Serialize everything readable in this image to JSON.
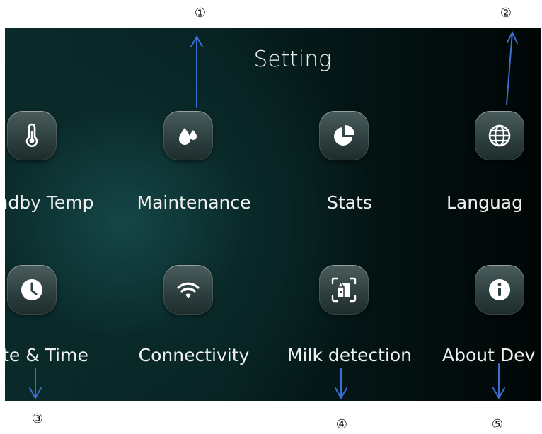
{
  "screen": {
    "title": "Setting",
    "accent": "#2f4040",
    "items": [
      {
        "label": "ndby Temp",
        "icon": "thermometer-icon"
      },
      {
        "label": "Maintenance",
        "icon": "water-drops-icon"
      },
      {
        "label": "Stats",
        "icon": "pie-chart-icon"
      },
      {
        "label": "Languag",
        "icon": "globe-icon"
      },
      {
        "label": "te & Time",
        "icon": "clock-icon"
      },
      {
        "label": "Connectivity",
        "icon": "wifi-icon"
      },
      {
        "label": "Milk detection",
        "icon": "milk-carton-scan-icon"
      },
      {
        "label": "About Dev",
        "icon": "info-icon"
      }
    ]
  },
  "annotations": {
    "color": "#3b6fd1",
    "markers": [
      "①",
      "②",
      "③",
      "④",
      "⑤"
    ]
  }
}
